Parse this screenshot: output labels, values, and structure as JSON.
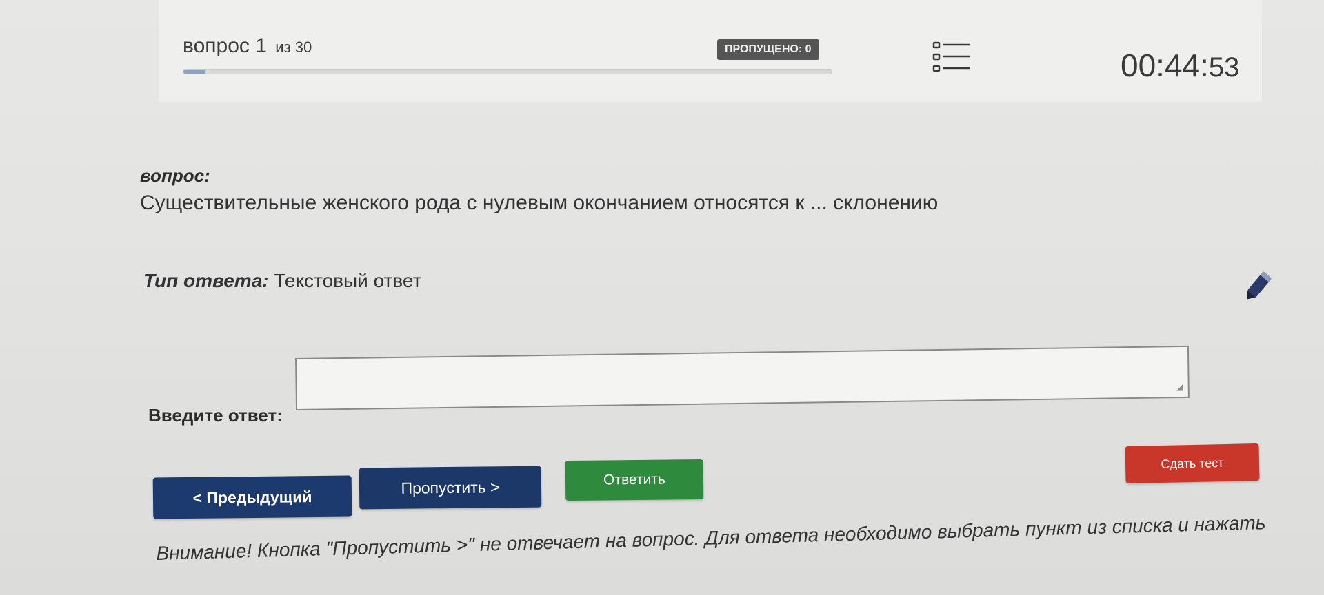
{
  "header": {
    "question_word": "вопрос",
    "question_number": "1",
    "question_of": "из 30",
    "progress": 0.033,
    "skipped_badge": "ПРОПУЩЕНО: 0",
    "list_icon": "question-list-icon",
    "timer_main": "00:44:",
    "timer_seconds": "53"
  },
  "question": {
    "label": "вопрос:",
    "text": "Существительные женского рода с нулевым окончанием относятся к ... склонению"
  },
  "answer_type": {
    "label": "Тип ответа:",
    "value": "Текстовый ответ"
  },
  "answer": {
    "label": "Введите ответ:",
    "value": ""
  },
  "buttons": {
    "previous": "< Предыдущий",
    "skip": "Пропустить >",
    "answer": "Ответить",
    "finish": "Сдать тест"
  },
  "notice": "Внимание! Кнопка \"Пропустить >\" не отвечает на вопрос. Для ответа необходимо выбрать пункт из списка и нажать",
  "icons": {
    "pencil": "pencil-icon"
  },
  "colors": {
    "primary_button": "#1d3a6e",
    "answer_button": "#2e8a3c",
    "finish_button": "#c9362a",
    "badge": "#555555"
  }
}
